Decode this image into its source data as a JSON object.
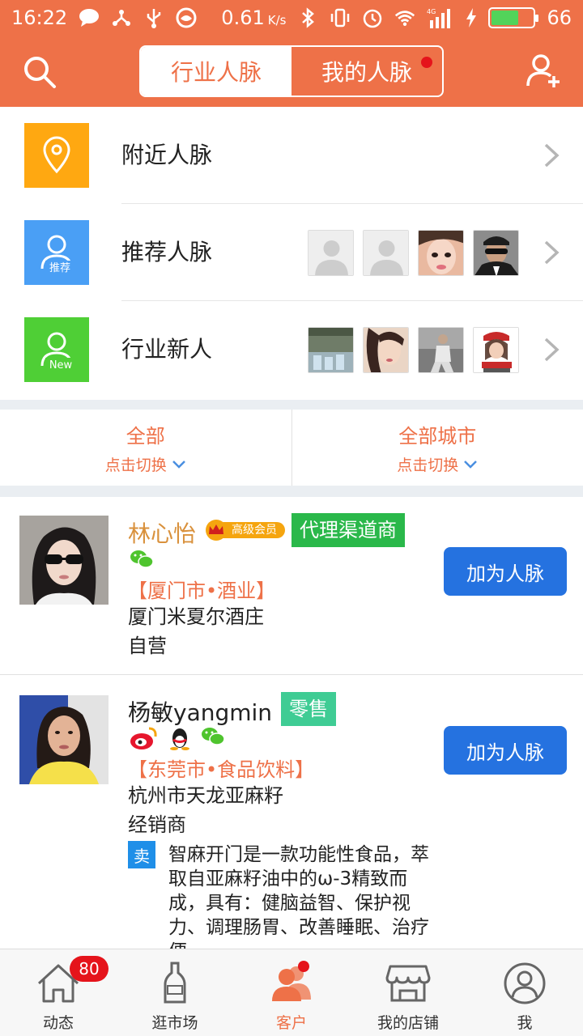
{
  "status_bar": {
    "time": "16:22",
    "network_speed": "0.61",
    "network_unit": "K/s",
    "signal_label": "4G",
    "battery_level": "66",
    "battery_fraction": 0.66
  },
  "header": {
    "tabs": [
      {
        "label": "行业人脉",
        "active": true
      },
      {
        "label": "我的人脉",
        "active": false,
        "has_dot": true
      }
    ]
  },
  "shortcuts": [
    {
      "label": "附近人脉",
      "icon": "location-pin-icon",
      "color": "#ffa811"
    },
    {
      "label": "推荐人脉",
      "icon": "recommend-person-icon",
      "icon_text": "推荐",
      "color": "#4a9ff5"
    },
    {
      "label": "行业新人",
      "icon": "new-person-icon",
      "icon_text": "New",
      "color": "#4fcf36"
    }
  ],
  "filter": {
    "industry": {
      "label": "全部",
      "hint": "点击切换"
    },
    "city": {
      "label": "全部城市",
      "hint": "点击切换"
    }
  },
  "contacts": [
    {
      "name": "林心怡",
      "vip_label": "高级会员",
      "tag": "代理渠道商",
      "tag_color": "#2ab84a",
      "region": "【厦门市•酒业】",
      "company_line1": "厦门米夏尔酒庄",
      "company_line2": "自营",
      "add_label": "加为人脉",
      "social": [
        "wechat-icon"
      ]
    },
    {
      "name": "杨敏yangmin",
      "tag": "零售",
      "tag_color": "#3fcc94",
      "region": "【东莞市•食品饮料】",
      "company_line1": "杭州市天龙亚麻籽",
      "company_line2": "经销商",
      "sell_badge": "卖",
      "sell_text": "智麻开门是一款功能性食品，萃取自亚麻籽油中的ω-3精致而成，具有：健脑益智、保护视力、调理肠胃、改善睡眠、治疗便",
      "add_label": "加为人脉",
      "social": [
        "weibo-icon",
        "qq-icon",
        "wechat-icon"
      ]
    }
  ],
  "bottom_nav": [
    {
      "label": "动态",
      "icon": "home-icon",
      "badge": "80"
    },
    {
      "label": "逛市场",
      "icon": "bottle-icon"
    },
    {
      "label": "客户",
      "icon": "customers-icon",
      "active": true,
      "has_dot": true
    },
    {
      "label": "我的店铺",
      "icon": "store-icon"
    },
    {
      "label": "我",
      "icon": "profile-icon"
    }
  ],
  "colors": {
    "brand": "#ee7148",
    "button_blue": "#2572e0",
    "badge_red": "#e5141b"
  }
}
